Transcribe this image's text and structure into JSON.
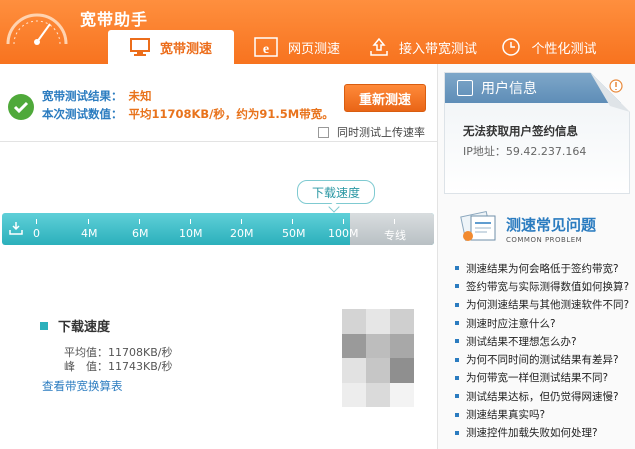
{
  "app": {
    "title": "宽带助手"
  },
  "tabs": [
    {
      "label": "宽带测速",
      "icon": "monitor-icon",
      "active": true
    },
    {
      "label": "网页测速",
      "icon": "ie-browser-icon",
      "active": false
    },
    {
      "label": "接入带宽测试",
      "icon": "upload-icon",
      "active": false
    },
    {
      "label": "个性化测试",
      "icon": "clock-icon",
      "active": false
    }
  ],
  "result": {
    "status_label": "宽带测试结果：",
    "status_value": "未知",
    "value_label": "本次测试数值：",
    "value_text": "平均11708KB/秒，约为91.5M带宽。",
    "retest_label": "重新测速",
    "simultaneous_upload_label": "同时测试上传速率"
  },
  "gauge": {
    "bubble_label": "下载速度",
    "scale_labels": [
      "0",
      "4M",
      "6M",
      "10M",
      "20M",
      "50M",
      "100M",
      "专线"
    ]
  },
  "download": {
    "title": "下载速度",
    "avg_label": "平均值：",
    "avg_value": "11708KB/秒",
    "peak_label": "峰　值：",
    "peak_value": "11743KB/秒",
    "conversion_link": "查看带宽换算表"
  },
  "user_info": {
    "title": "用户信息",
    "message": "无法获取用户签约信息",
    "ip_label": "IP地址：",
    "ip_value": "59.42.237.164"
  },
  "faq": {
    "title": "测速常见问题",
    "subtitle": "COMMON PROBLEM",
    "items": [
      "测速结果为何会略低于签约带宽?",
      "签约带宽与实际测得数值如何换算?",
      "为何测速结果与其他测速软件不同?",
      "测速时应注意什么?",
      "测试结果不理想怎么办?",
      "为何不同时间的测试结果有差异?",
      "为何带宽一样但测试结果不同?",
      "测试结果达标，但仍觉得网速慢?",
      "测速结果真实吗?",
      "测速控件加载失败如何处理?"
    ]
  },
  "colors": {
    "header_orange": "#f7731f",
    "accent_orange": "#e8731c",
    "accent_blue": "#2b7cc0",
    "bar_teal": "#2bb0bb",
    "success_green": "#4fa93a"
  }
}
